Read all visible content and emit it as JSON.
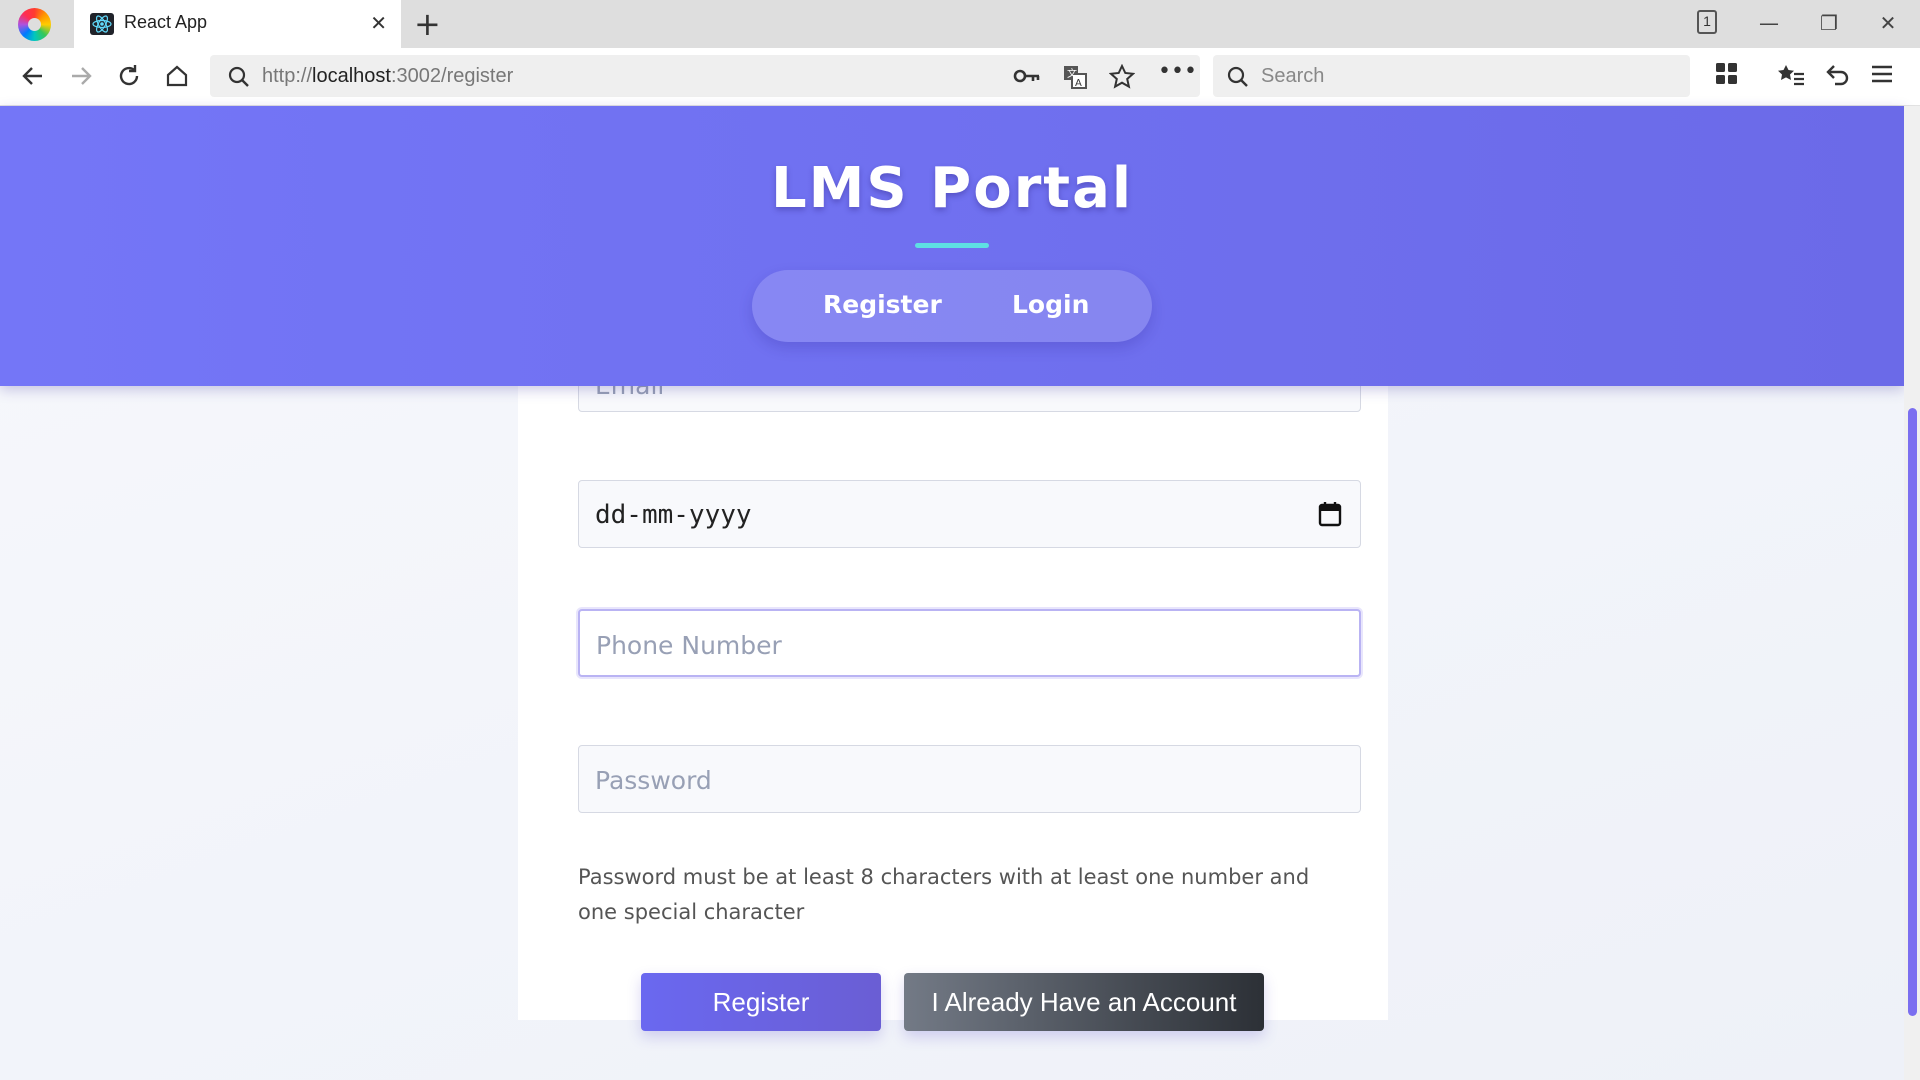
{
  "browser": {
    "tab_title": "React App",
    "tab_count": "1",
    "url_prefix": "http://",
    "url_host": "localhost",
    "url_rest": ":3002/register",
    "search_placeholder": "Search"
  },
  "header": {
    "title": "LMS Portal",
    "nav": {
      "register": "Register",
      "login": "Login"
    }
  },
  "form": {
    "email_placeholder": "Email",
    "dob_value": "dd-mm-yyyy",
    "phone_placeholder": "Phone Number",
    "password_placeholder": "Password",
    "password_hint": "Password must be at least 8 characters with at least one number and one special character",
    "register_button": "Register",
    "existing_account_button": "I Already Have an Account"
  },
  "colors": {
    "header_gradient_start": "#7476f7",
    "header_gradient_end": "#6b6ae8",
    "accent_underline": "#5ee0e3",
    "register_button": "#6a68f0",
    "account_button": "#2c3036"
  }
}
